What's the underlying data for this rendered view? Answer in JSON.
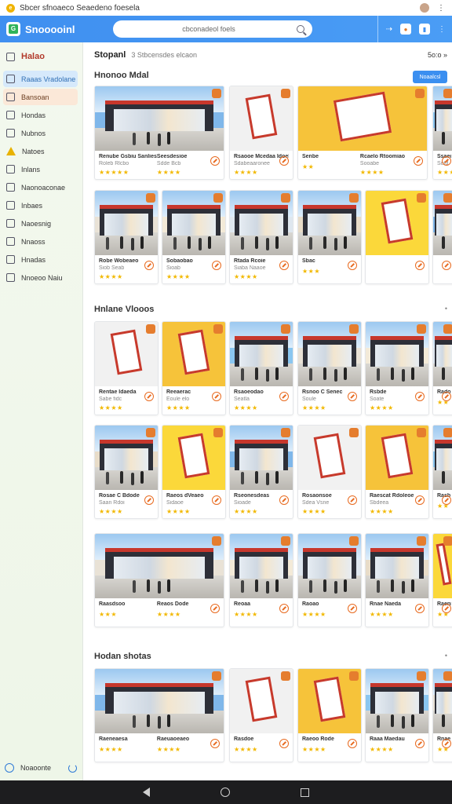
{
  "statusbar": {
    "title": "Sbcer sfnoaeco Seaedeno foesela"
  },
  "appbar": {
    "title": "Snooooinl",
    "search_placeholder": "cbconadeol foels"
  },
  "sidebar": {
    "header": "Halao",
    "items": [
      {
        "label": "Raaas Vradolane",
        "icon": "search-icon",
        "state": "active-blue"
      },
      {
        "label": "Bansoan",
        "icon": "tag-icon",
        "state": "active-peach"
      },
      {
        "label": "Hondas",
        "icon": "grid-icon",
        "state": ""
      },
      {
        "label": "Nubnos",
        "icon": "folder-icon",
        "state": ""
      },
      {
        "label": "Natoes",
        "icon": "warning-icon",
        "state": ""
      },
      {
        "label": "Inlans",
        "icon": "list-icon",
        "state": ""
      },
      {
        "label": "Naonoaconae",
        "icon": "document-icon",
        "state": ""
      },
      {
        "label": "Inbaes",
        "icon": "inbox-icon",
        "state": ""
      },
      {
        "label": "Naoesnig",
        "icon": "bookmark-icon",
        "state": ""
      },
      {
        "label": "Nnaoss",
        "icon": "link-icon",
        "state": ""
      },
      {
        "label": "Hnadas",
        "icon": "card-icon",
        "state": ""
      },
      {
        "label": "Nnoeoo Naiu",
        "icon": "home-icon",
        "state": ""
      }
    ],
    "footer": "Noaoonte"
  },
  "main": {
    "breadcrumb_title": "Stopanl",
    "breadcrumb_sub": "3 Stbcensdes elcaon",
    "pager": "5o:o »",
    "sections": [
      {
        "title": "Hnonoo Mdal",
        "button": "Noaalcsl",
        "cards": [
          {
            "name": "Renube Gsbiu Sanlies",
            "sub": "Roleb Rlcbo",
            "stars": "★★★★★"
          },
          {
            "name": "Seesdesioe",
            "sub": "Sdde Bcb",
            "stars": "★★★★"
          },
          {
            "name": "Rsaooe Mcedaa Idoelaroe",
            "sub": "Sdabeaaronee",
            "stars": "★★★★"
          },
          {
            "name": "Senbe",
            "sub": "",
            "stars": "★★"
          },
          {
            "name": "Rcaelo Rtoomiao",
            "sub": "Sooabe",
            "stars": "★★★★"
          },
          {
            "name": "Ssaede",
            "sub": "Sotd",
            "stars": "★★★★"
          },
          {
            "name": "Robe Wobeaeo",
            "sub": "Siob Seab",
            "stars": "★★★★"
          },
          {
            "name": "Sobaobao",
            "sub": "Sioab",
            "stars": "★★★★"
          },
          {
            "name": "Rtada Rcoie",
            "sub": "Siaba Naaoe",
            "stars": "★★★★"
          },
          {
            "name": "Sbac",
            "sub": "",
            "stars": "★★★"
          }
        ]
      },
      {
        "title": "Hnlane Vlooos",
        "cards": [
          {
            "name": "Rentae Idaeda",
            "sub": "Sabe fidc",
            "stars": "★★★★"
          },
          {
            "name": "Reeaerac",
            "sub": "Eoule elo",
            "stars": "★★★★"
          },
          {
            "name": "Rsaoeodao",
            "sub": "Seatla",
            "stars": "★★★★"
          },
          {
            "name": "Rsnoo C Senec",
            "sub": "Soule",
            "stars": "★★★★"
          },
          {
            "name": "Rsbde",
            "sub": "Soate",
            "stars": "★★★★"
          },
          {
            "name": "Rado",
            "sub": "",
            "stars": "★★"
          },
          {
            "name": "Rosae C Bdode",
            "sub": "Saan Rdoi",
            "stars": "★★★★"
          },
          {
            "name": "Raeos dVeaeo",
            "sub": "Sidaoe",
            "stars": "★★★★"
          },
          {
            "name": "Rseonesdeas",
            "sub": "Sioade",
            "stars": "★★★★"
          },
          {
            "name": "Rosaonsoe",
            "sub": "Sdea Vsne",
            "stars": "★★★★"
          },
          {
            "name": "Raescat Rdoleoe",
            "sub": "Sbdeea",
            "stars": "★★★★"
          },
          {
            "name": "Rasb",
            "sub": "",
            "stars": "★★"
          },
          {
            "name": "Raasdsoo",
            "sub": "",
            "stars": "★★★"
          },
          {
            "name": "Reaos Dode",
            "sub": "",
            "stars": "★★★★"
          },
          {
            "name": "Reoaa",
            "sub": "",
            "stars": "★★★★"
          },
          {
            "name": "Raoao",
            "sub": "",
            "stars": "★★★★"
          },
          {
            "name": "Rnae Naeda",
            "sub": "",
            "stars": "★★★★"
          },
          {
            "name": "Raenn",
            "sub": "",
            "stars": "★★"
          }
        ]
      },
      {
        "title": "Hodan shotas",
        "cards": [
          {
            "name": "Raeneaesa",
            "sub": "",
            "stars": "★★★★"
          },
          {
            "name": "Raeuaoeaeo",
            "sub": "",
            "stars": "★★★★"
          },
          {
            "name": "Rasdoe",
            "sub": "",
            "stars": "★★★★"
          },
          {
            "name": "Raeoo Rode",
            "sub": "",
            "stars": "★★★★"
          },
          {
            "name": "Raaa Maedau",
            "sub": "",
            "stars": "★★★★"
          },
          {
            "name": "Rnae",
            "sub": "",
            "stars": "★★"
          }
        ]
      }
    ]
  },
  "colors": {
    "accent": "#3f8ff0",
    "star": "#f2b800",
    "action": "#e86a1f"
  }
}
